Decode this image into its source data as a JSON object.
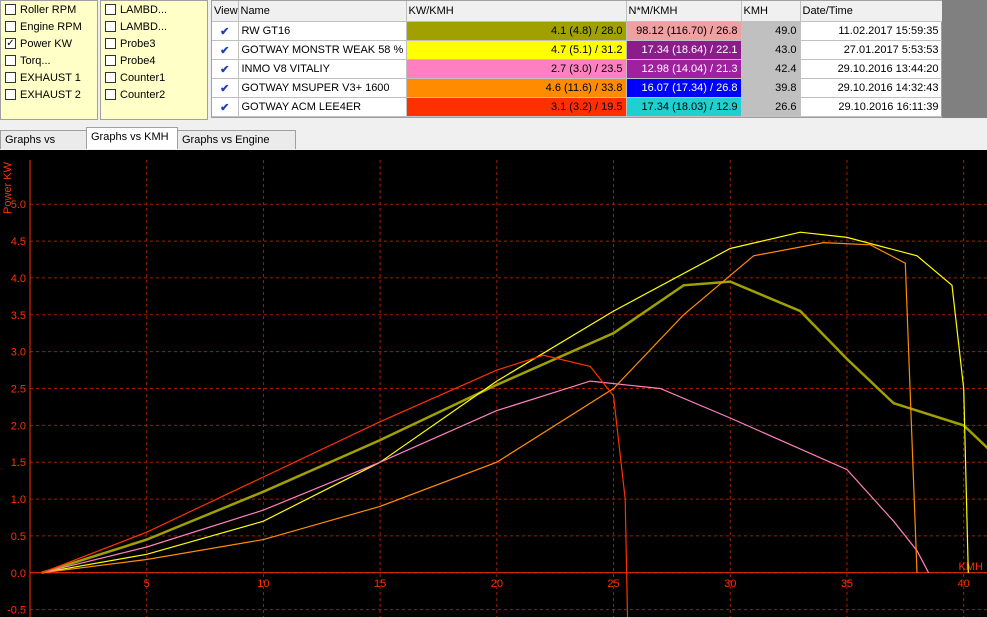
{
  "channels_col1": [
    {
      "label": "Roller RPM",
      "checked": false
    },
    {
      "label": "Engine RPM",
      "checked": false
    },
    {
      "label": "Power KW",
      "checked": true
    },
    {
      "label": "Torq...",
      "checked": false
    },
    {
      "label": "EXHAUST 1",
      "checked": false
    },
    {
      "label": "EXHAUST 2",
      "checked": false
    }
  ],
  "channels_col2": [
    {
      "label": "LAMBD...",
      "checked": false
    },
    {
      "label": "LAMBD...",
      "checked": false
    },
    {
      "label": "Probe3",
      "checked": false
    },
    {
      "label": "Probe4",
      "checked": false
    },
    {
      "label": "Counter1",
      "checked": false
    },
    {
      "label": "Counter2",
      "checked": false
    }
  ],
  "runs_table": {
    "headers": [
      "View",
      "Name",
      "KW/KMH",
      "N*M/KMH",
      "KMH",
      "Date/Time"
    ],
    "rows": [
      {
        "name": "RW GT16",
        "kw": "4.1 (4.8) / 28.0",
        "nm": "98.12 (116.70) / 26.8",
        "kmh": "49.0",
        "datetime": "11.02.2017 15:59:35",
        "kw_color": "#a0a000",
        "nm_color": "#f0a0a0",
        "nm_text": "#000000"
      },
      {
        "name": "GOTWAY MONSTR WEAK 58 %",
        "kw": "4.7 (5.1) / 31.2",
        "nm": "17.34 (18.64) / 22.1",
        "kmh": "43.0",
        "datetime": "27.01.2017 5:53:53",
        "kw_color": "#ffff00",
        "nm_color": "#8b1d8b",
        "nm_text": "#ffffff"
      },
      {
        "name": "INMO V8 VITALIY",
        "kw": "2.7 (3.0) / 23.5",
        "nm": "12.98 (14.04) / 21.3",
        "kmh": "42.4",
        "datetime": "29.10.2016 13:44:20",
        "kw_color": "#ff80c0",
        "nm_color": "#a020a0",
        "nm_text": "#ffffff"
      },
      {
        "name": "GOTWAY MSUPER V3+ 1600",
        "kw": "4.6 (11.6) / 33.8",
        "nm": "16.07 (17.34) / 26.8",
        "kmh": "39.8",
        "datetime": "29.10.2016 14:32:43",
        "kw_color": "#ff8c00",
        "nm_color": "#0000ff",
        "nm_text": "#ffffff"
      },
      {
        "name": "GOTWAY ACM LEE4ER",
        "kw": "3.1 (3.2) / 19.5",
        "nm": "17.34 (18.03) / 12.9",
        "kmh": "26.6",
        "datetime": "29.10.2016 16:11:39",
        "kw_color": "#ff3000",
        "nm_color": "#20d0d0",
        "nm_text": "#000000"
      }
    ]
  },
  "tabs": [
    "Graphs vs Time",
    "Graphs vs KMH",
    "Graphs vs Engine RPM"
  ],
  "active_tab": 1,
  "chart_data": {
    "type": "line",
    "ylabel": "Power KW",
    "xlabel": "KMH",
    "xlim": [
      0,
      41
    ],
    "ylim": [
      -0.6,
      5.6
    ],
    "xticks": [
      5,
      10,
      15,
      20,
      25,
      30,
      35,
      40
    ],
    "yticks": [
      -0.5,
      0.0,
      0.5,
      1.0,
      1.5,
      2.0,
      2.5,
      3.0,
      3.5,
      4.0,
      4.5,
      5.0
    ],
    "grid": true,
    "series": [
      {
        "name": "RW GT16",
        "color": "#a0a000",
        "x": [
          0.5,
          5,
          10,
          15,
          20,
          25,
          28,
          30,
          33,
          35,
          37,
          40,
          42
        ],
        "y": [
          0,
          0.45,
          1.1,
          1.8,
          2.55,
          3.25,
          3.9,
          3.95,
          3.55,
          2.9,
          2.3,
          2.0,
          1.4
        ]
      },
      {
        "name": "GOTWAY MONSTR WEAK 58 %",
        "color": "#ffff00",
        "x": [
          0.5,
          5,
          10,
          15,
          20,
          25,
          30,
          33,
          35,
          38,
          39.5,
          40,
          40.2
        ],
        "y": [
          0,
          0.25,
          0.7,
          1.5,
          2.6,
          3.55,
          4.4,
          4.62,
          4.55,
          4.3,
          3.9,
          2.5,
          0
        ]
      },
      {
        "name": "INMO V8 VITALIY",
        "color": "#ff80c0",
        "x": [
          0.5,
          5,
          10,
          15,
          20,
          24,
          27,
          30,
          35,
          37,
          38,
          38.5
        ],
        "y": [
          0,
          0.35,
          0.85,
          1.5,
          2.2,
          2.6,
          2.5,
          2.1,
          1.4,
          0.7,
          0.3,
          0
        ]
      },
      {
        "name": "GOTWAY MSUPER V3+ 1600",
        "color": "#ff8c00",
        "x": [
          0.5,
          5,
          10,
          15,
          20,
          25,
          28,
          31,
          34,
          36,
          37.5,
          38
        ],
        "y": [
          0,
          0.18,
          0.45,
          0.9,
          1.5,
          2.5,
          3.5,
          4.3,
          4.48,
          4.45,
          4.2,
          0
        ]
      },
      {
        "name": "GOTWAY ACM LEE4ER",
        "color": "#ff3000",
        "x": [
          0.5,
          5,
          10,
          15,
          20,
          22,
          24,
          25,
          25.5,
          25.6
        ],
        "y": [
          0,
          0.55,
          1.3,
          2.05,
          2.75,
          2.95,
          2.8,
          2.4,
          1.0,
          -0.6
        ]
      }
    ]
  }
}
